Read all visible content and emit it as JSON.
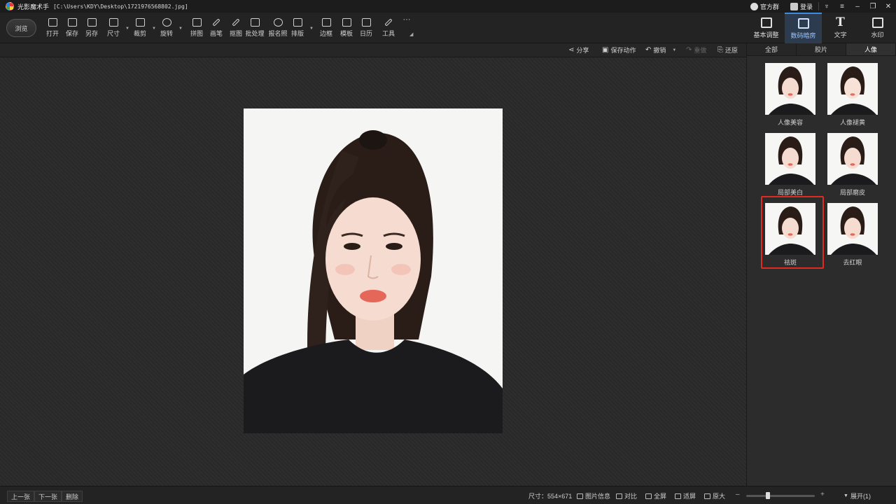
{
  "window": {
    "app_name": "光影魔术手",
    "file_path": "[C:\\Users\\KDY\\Desktop\\1721976568802.jpg]",
    "right_items": [
      {
        "label": "官方群",
        "icon": "chat-icon"
      },
      {
        "label": "登录",
        "icon": "login-icon"
      }
    ],
    "controls": [
      "skin-icon",
      "menu-icon",
      "minimize-icon",
      "restore-icon",
      "close-icon"
    ]
  },
  "toolbar": {
    "browse_label": "浏览",
    "tools": [
      {
        "label": "打开",
        "icon": "open-icon"
      },
      {
        "label": "保存",
        "icon": "save-icon"
      },
      {
        "label": "另存",
        "icon": "save-as-icon"
      },
      {
        "label": "尺寸",
        "icon": "resize-icon"
      },
      {
        "label": "裁剪",
        "icon": "crop-icon"
      },
      {
        "label": "旋转",
        "icon": "rotate-icon"
      },
      {
        "label": "拼图",
        "icon": "collage-icon"
      },
      {
        "label": "画笔",
        "icon": "brush-icon"
      },
      {
        "label": "抠图",
        "icon": "cutout-icon"
      },
      {
        "label": "批处理",
        "icon": "batch-icon"
      },
      {
        "label": "报名照",
        "icon": "id-photo-icon"
      },
      {
        "label": "排版",
        "icon": "layout-icon"
      },
      {
        "label": "边框",
        "icon": "border-icon"
      },
      {
        "label": "模板",
        "icon": "template-icon"
      },
      {
        "label": "日历",
        "icon": "calendar-icon"
      },
      {
        "label": "工具",
        "icon": "tools-icon"
      },
      {
        "label": "···",
        "icon": "more-icon"
      }
    ],
    "mode_tabs": [
      {
        "label": "基本调整",
        "icon": "adjust-icon"
      },
      {
        "label": "数码暗房",
        "icon": "darkroom-icon",
        "active": true
      },
      {
        "label": "文字",
        "icon": "text-icon"
      },
      {
        "label": "水印",
        "icon": "watermark-icon"
      }
    ]
  },
  "actions": {
    "share": "分享",
    "save_action": "保存动作",
    "undo": "撤销",
    "redo": "重做",
    "restore": "还原"
  },
  "panel": {
    "tabs": [
      "全部",
      "胶片",
      "人像"
    ],
    "active_tab": "人像",
    "effects": [
      {
        "label": "人像美容"
      },
      {
        "label": "人像褪黄"
      },
      {
        "label": "局部美白"
      },
      {
        "label": "局部磨皮"
      },
      {
        "label": "祛斑",
        "selected": true
      },
      {
        "label": "去红眼"
      }
    ]
  },
  "status": {
    "prev": "上一张",
    "next": "下一张",
    "delete": "删除",
    "size": "尺寸：554×671",
    "info": "图片信息",
    "compare": "对比",
    "fullscreen": "全屏",
    "fit": "适屏",
    "original": "原大",
    "zoom_level": 0.3,
    "expand": "展开(1)"
  },
  "colors": {
    "selection": "#e02b20",
    "active_tab_accent": "#3b8de0"
  }
}
